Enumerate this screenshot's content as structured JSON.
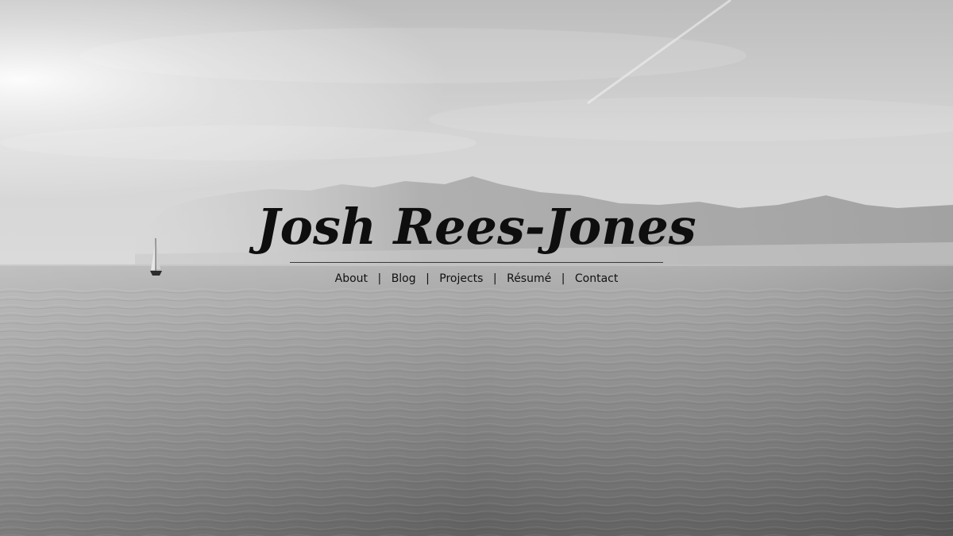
{
  "site": {
    "title": "Josh Rees-Jones"
  },
  "nav": {
    "separator": "|",
    "items": [
      {
        "label": "About"
      },
      {
        "label": "Blog"
      },
      {
        "label": "Projects"
      },
      {
        "label": "Résumé"
      },
      {
        "label": "Contact"
      }
    ]
  },
  "theme": {
    "title_color": "#0e0e0e",
    "background": "grayscale seascape photo"
  }
}
